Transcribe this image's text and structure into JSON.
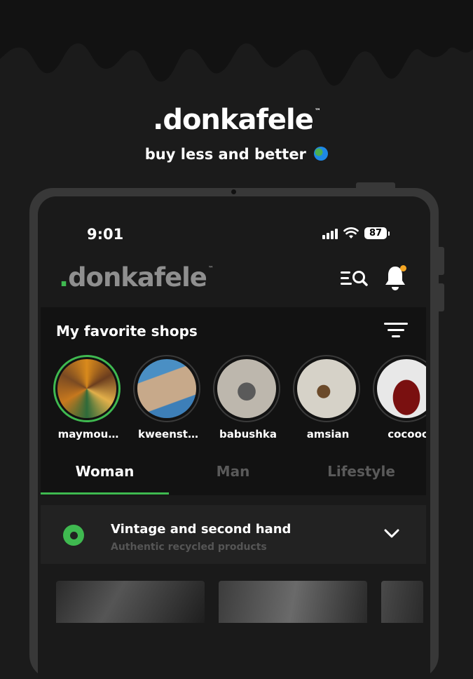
{
  "promo": {
    "logo_text": ".donkafele",
    "trademark": "™",
    "tagline": "buy less and better"
  },
  "status_bar": {
    "time": "9:01",
    "battery": "87"
  },
  "header": {
    "logo_text": "donkafele",
    "logo_dot": ".",
    "trademark": "™"
  },
  "favorites": {
    "title": "My favorite shops",
    "shops": [
      {
        "name": "maymou…",
        "active": true
      },
      {
        "name": "kweenst…",
        "active": false
      },
      {
        "name": "babushka",
        "active": false
      },
      {
        "name": "amsian",
        "active": false
      },
      {
        "name": "cocooc",
        "active": false
      }
    ]
  },
  "tabs": [
    {
      "label": "Woman",
      "active": true
    },
    {
      "label": "Man",
      "active": false
    },
    {
      "label": "Lifestyle",
      "active": false
    }
  ],
  "category": {
    "title": "Vintage and second hand",
    "subtitle": "Authentic recycled products"
  },
  "colors": {
    "accent": "#3fb950",
    "notification": "#f5a623",
    "background": "#1b1b1b"
  },
  "icons": [
    "search-list-icon",
    "bell-icon",
    "filter-icon",
    "chevron-down-icon",
    "radio-selected-icon",
    "globe-icon",
    "signal-icon",
    "wifi-icon",
    "battery-icon"
  ]
}
